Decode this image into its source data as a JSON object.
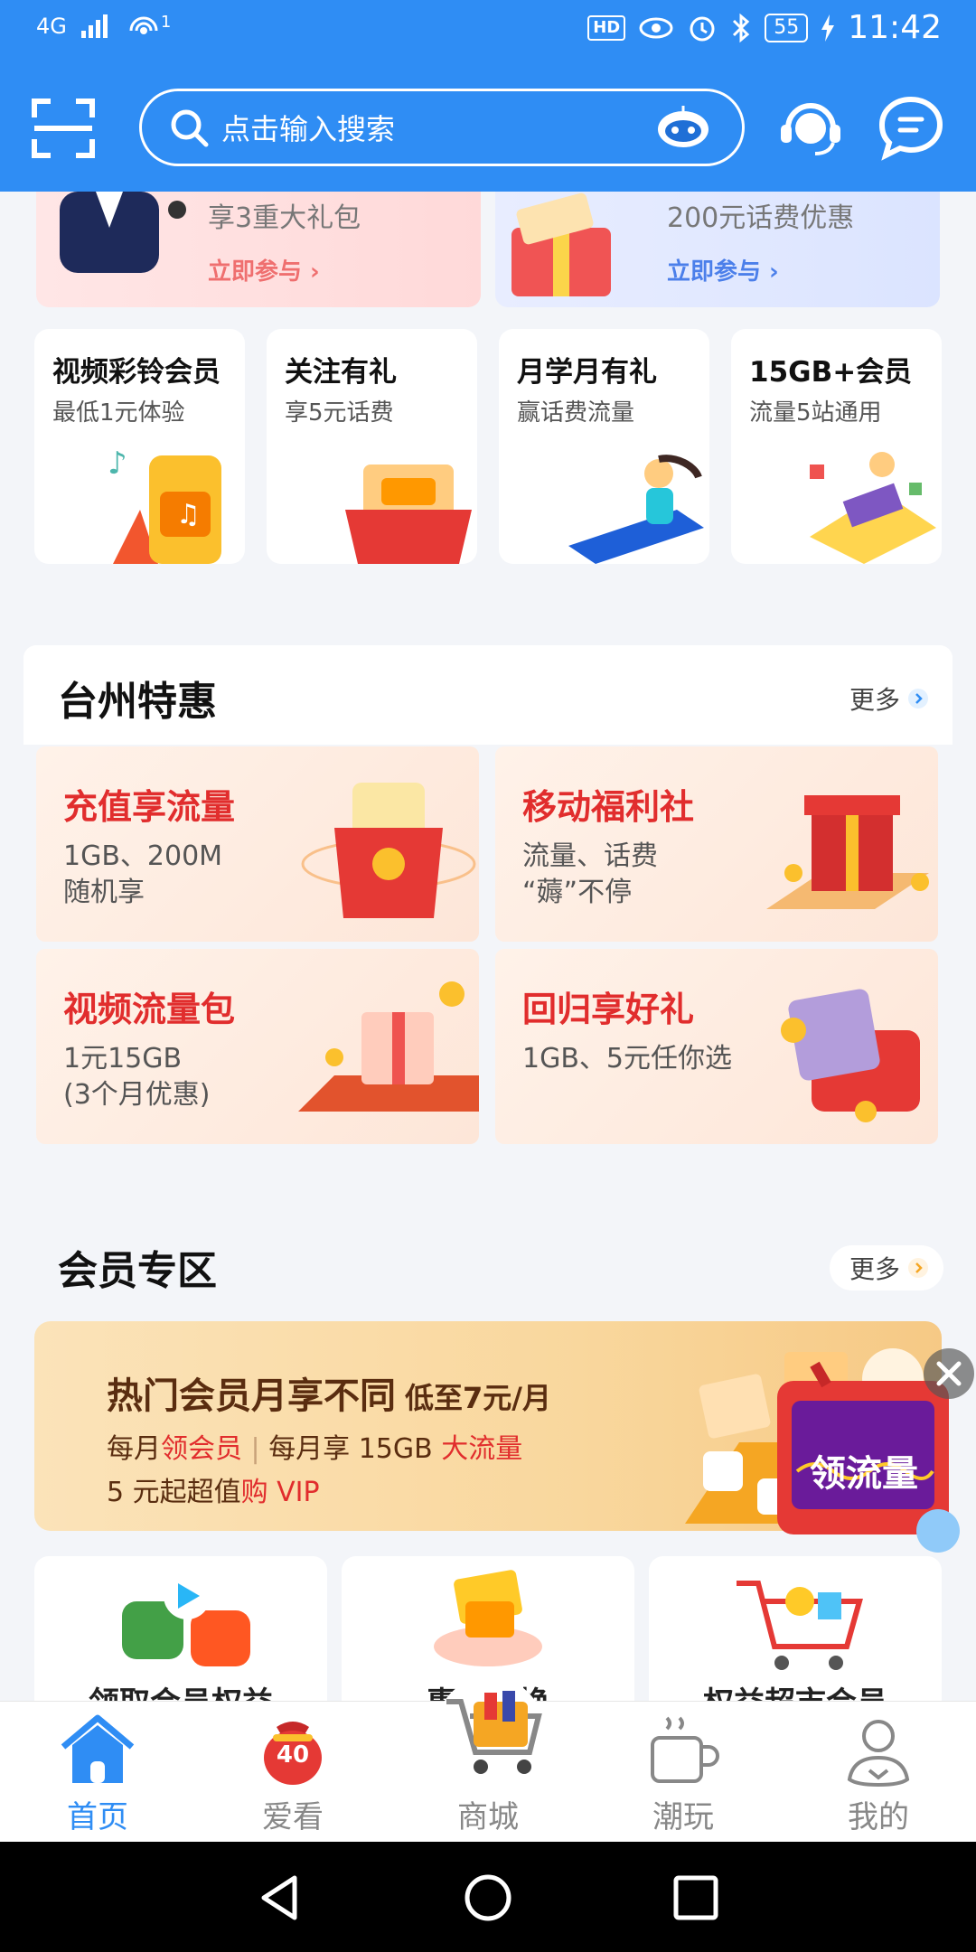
{
  "status_bar": {
    "network": "4G",
    "signal": "4G",
    "hotspot": "1",
    "hd": "HD",
    "battery": "55",
    "time": "11:42"
  },
  "header": {
    "search_placeholder": "点击输入搜索"
  },
  "promos": [
    {
      "text": "享3重大礼包",
      "join": "立即参与 ›"
    },
    {
      "text": "200元话费优惠",
      "join": "立即参与 ›"
    }
  ],
  "feature_cards": [
    {
      "title": "视频彩铃会员",
      "subtitle": "最低1元体验"
    },
    {
      "title": "关注有礼",
      "subtitle": "享5元话费"
    },
    {
      "title": "月学月有礼",
      "subtitle": "赢话费流量"
    },
    {
      "title": "15GB+会员",
      "subtitle": "流量5站通用"
    }
  ],
  "taizhou": {
    "title": "台州特惠",
    "more": "更多",
    "items": [
      {
        "title": "充值享流量",
        "desc": "1GB、200M\n随机享"
      },
      {
        "title": "移动福利社",
        "desc": "流量、话费\n“薅”不停"
      },
      {
        "title": "视频流量包",
        "desc": "1元15GB\n(3个月优惠)"
      },
      {
        "title": "回归享好礼",
        "desc": "1GB、5元任你选"
      }
    ]
  },
  "member": {
    "title": "会员专区",
    "more": "更多",
    "banner": {
      "headline": "热门会员月享不同",
      "headline_small": "低至7元/月",
      "line2_a": "每月",
      "line2_b": "领会员",
      "line2_c": "每月享 15GB",
      "line2_d": "大流量",
      "line3_a": "5 元起超值",
      "line3_b": "购 VIP"
    },
    "float_ad": "领流量",
    "cards": [
      "领取会员权益",
      "惠品兑换",
      "权益超市会员"
    ]
  },
  "tabs": [
    {
      "label": "首页",
      "icon": "home-icon"
    },
    {
      "label": "爱看",
      "icon": "red-packet-icon",
      "badge": "40"
    },
    {
      "label": "商城",
      "icon": "shopping-cart-icon"
    },
    {
      "label": "潮玩",
      "icon": "cup-icon"
    },
    {
      "label": "我的",
      "icon": "user-icon"
    }
  ],
  "colors": {
    "primary": "#2f8df4",
    "accent_red": "#e12d2d"
  }
}
